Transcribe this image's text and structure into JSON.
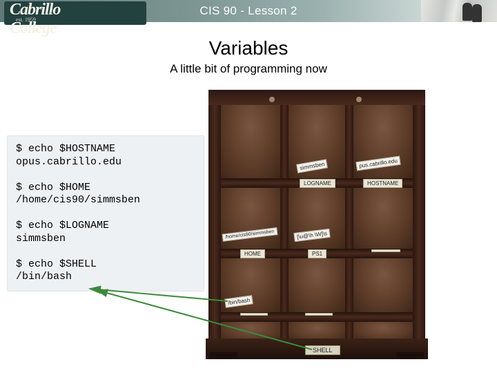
{
  "header": {
    "course_title": "CIS 90 - Lesson 2",
    "logo_text": "Cabrillo College",
    "logo_sub": "est. 1959"
  },
  "headings": {
    "title": "Variables",
    "subtitle": "A little bit of programming now"
  },
  "terminal": {
    "blocks": [
      "$ echo $HOSTNAME\nopus.cabrillo.edu",
      "$ echo $HOME\n/home/cis90/simmsben",
      "$ echo $LOGNAME\nsimmsben",
      "$ echo $SHELL\n/bin/bash"
    ]
  },
  "shelf": {
    "cubby_tags": {
      "r1_m": "simmsben",
      "r1_r": "pus.cabrillo.edu",
      "front_r1_m": "LOGNAME",
      "front_r1_r": "HOSTNAME",
      "r2_l": "/home/cis90/simmsben",
      "r2_m": "[\\u@\\h \\W]\\s",
      "front_r2_l": "HOME",
      "front_r2_m": "PS1",
      "front_r2_r": "",
      "r3_l": "/bin/bash",
      "front_r3_l": "",
      "front_r3_m": ""
    },
    "base_label": "SHELL"
  }
}
